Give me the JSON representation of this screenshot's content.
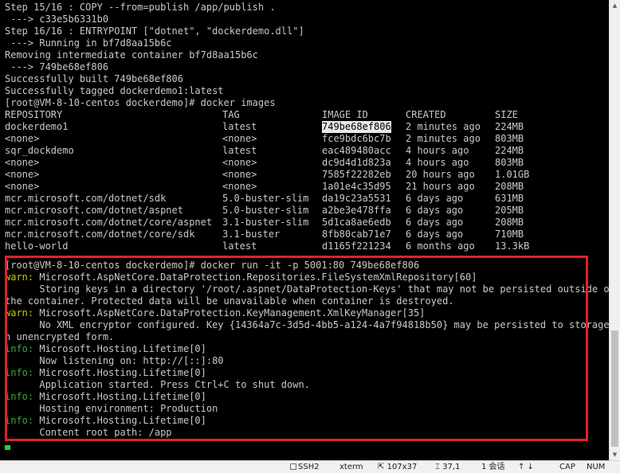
{
  "terminal": {
    "top_lines": [
      "Step 15/16 : COPY --from=publish /app/publish .",
      " ---> c33e5b6331b0",
      "Step 16/16 : ENTRYPOINT [\"dotnet\", \"dockerdemo.dll\"]",
      " ---> Running in bf7d8aa15b6c",
      "Removing intermediate container bf7d8aa15b6c",
      " ---> 749be68ef806",
      "Successfully built 749be68ef806",
      "Successfully tagged dockerdemo1:latest",
      "[root@VM-8-10-centos dockerdemo]# docker images"
    ],
    "images_header": [
      "REPOSITORY",
      "TAG",
      "IMAGE ID",
      "CREATED",
      "SIZE"
    ],
    "images_rows": [
      [
        "dockerdemo1",
        "latest",
        "749be68ef806",
        "2 minutes ago",
        "224MB"
      ],
      [
        "<none>",
        "<none>",
        "fce9bdc6bc7b",
        "2 minutes ago",
        "803MB"
      ],
      [
        "sqr_dockdemo",
        "latest",
        "eac489480acc",
        "4 hours ago",
        "224MB"
      ],
      [
        "<none>",
        "<none>",
        "dc9d4d1d823a",
        "4 hours ago",
        "803MB"
      ],
      [
        "<none>",
        "<none>",
        "7585f22282eb",
        "20 hours ago",
        "1.01GB"
      ],
      [
        "<none>",
        "<none>",
        "1a01e4c35d95",
        "21 hours ago",
        "208MB"
      ],
      [
        "mcr.microsoft.com/dotnet/sdk",
        "5.0-buster-slim",
        "da19c23a5531",
        "6 days ago",
        "631MB"
      ],
      [
        "mcr.microsoft.com/dotnet/aspnet",
        "5.0-buster-slim",
        "a2be3e478ffa",
        "6 days ago",
        "205MB"
      ],
      [
        "mcr.microsoft.com/dotnet/core/aspnet",
        "3.1-buster-slim",
        "5d1ca8ae6edb",
        "6 days ago",
        "208MB"
      ],
      [
        "mcr.microsoft.com/dotnet/core/sdk",
        "3.1-buster",
        "8fb80cab71e7",
        "6 days ago",
        "710MB"
      ],
      [
        "hello-world",
        "latest",
        "d1165f221234",
        "6 months ago",
        "13.3kB"
      ]
    ],
    "run_command": "[root@VM-8-10-centos dockerdemo]# docker run -it -p 5001:80 749be68ef806",
    "log": [
      {
        "level": "warn",
        "source": "Microsoft.AspNetCore.DataProtection.Repositories.FileSystemXmlRepository[60]"
      },
      {
        "text": "      Storing keys in a directory '/root/.aspnet/DataProtection-Keys' that may not be persisted outside of"
      },
      {
        "text": "the container. Protected data will be unavailable when container is destroyed."
      },
      {
        "level": "warn",
        "source": "Microsoft.AspNetCore.DataProtection.KeyManagement.XmlKeyManager[35]"
      },
      {
        "text": "      No XML encryptor configured. Key {14364a7c-3d5d-4bb5-a124-4a7f94818b50} may be persisted to storage i"
      },
      {
        "text": "n unencrypted form."
      },
      {
        "level": "info",
        "source": "Microsoft.Hosting.Lifetime[0]"
      },
      {
        "text": "      Now listening on: http://[::]:80"
      },
      {
        "level": "info",
        "source": "Microsoft.Hosting.Lifetime[0]"
      },
      {
        "text": "      Application started. Press Ctrl+C to shut down."
      },
      {
        "level": "info",
        "source": "Microsoft.Hosting.Lifetime[0]"
      },
      {
        "text": "      Hosting environment: Production"
      },
      {
        "level": "info",
        "source": "Microsoft.Hosting.Lifetime[0]"
      },
      {
        "text": "      Content root path: /app"
      }
    ],
    "level_labels": {
      "warn": "warn:",
      "info": "info:"
    },
    "selected_image_id": "749be68ef806"
  },
  "status_bar": {
    "protocol": "SSH2",
    "terminal_type": "xterm",
    "size": "107x37",
    "cursor_pos": "37,1",
    "sessions": "1 会话",
    "caps": "CAP",
    "num": "NUM"
  },
  "colors": {
    "highlight_border": "#e0202a",
    "warn": "#c8c800",
    "info": "#3fa33f",
    "cursor": "#1fd13a",
    "text": "#c8c8c8",
    "background": "#000000"
  },
  "icons": {
    "scroll_up": "triangle-up-icon",
    "scroll_down": "triangle-down-icon"
  }
}
